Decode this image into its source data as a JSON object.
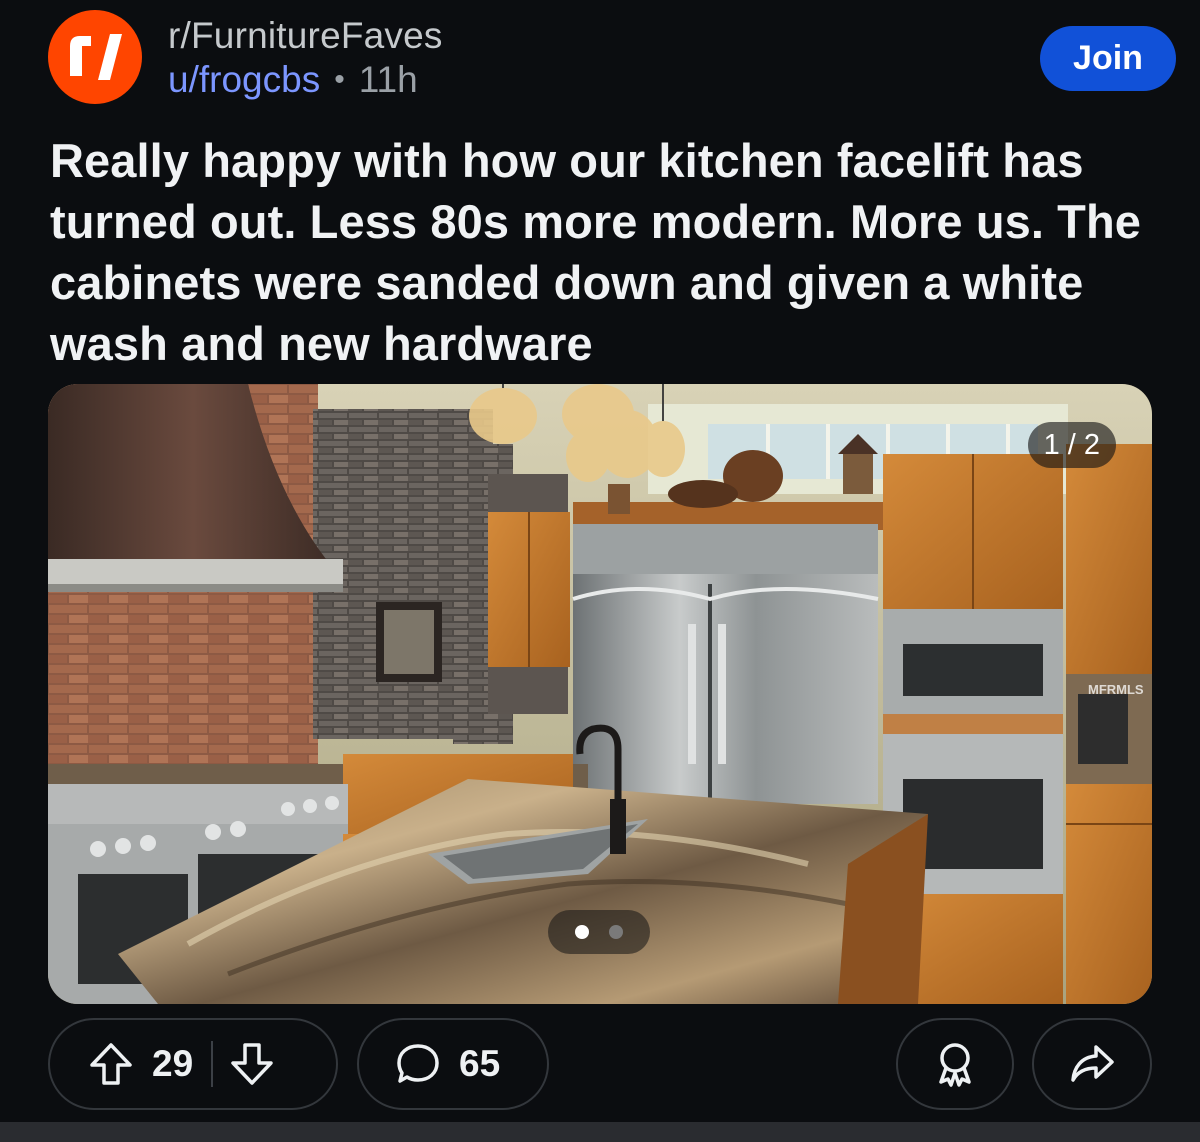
{
  "header": {
    "subreddit": "r/FurnitureFaves",
    "username": "u/frogcbs",
    "separator": "•",
    "age": "11h",
    "join_label": "Join",
    "avatar_icon": "reddit-r-logo-icon",
    "avatar_color": "#ff4500"
  },
  "post": {
    "title": "Really happy with how our kitchen facelift has turned out. Less 80s more modern. More us. The cabinets were sanded down and given a white wash and new hardware"
  },
  "media": {
    "counter": "1 / 2",
    "watermark": "MFRMLS",
    "current_page": 1,
    "total_pages": 2
  },
  "actions": {
    "upvote_icon": "upvote-arrow-icon",
    "downvote_icon": "downvote-arrow-icon",
    "vote_count": "29",
    "comment_icon": "comment-bubble-icon",
    "comment_count": "65",
    "award_icon": "award-icon",
    "share_icon": "share-arrow-icon"
  },
  "colors": {
    "background": "#0b0d10",
    "accent": "#1151d8",
    "username": "#7c96ff"
  }
}
